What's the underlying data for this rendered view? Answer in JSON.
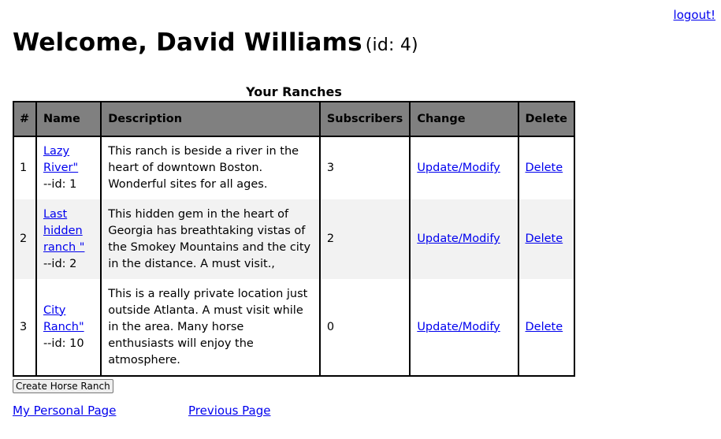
{
  "header": {
    "logout_label": "logout!",
    "welcome_text": "Welcome, David Williams",
    "user_id_text": "(id: 4)"
  },
  "table": {
    "caption": "Your Ranches",
    "columns": [
      "#",
      "Name",
      "Description",
      "Subscribers",
      "Change",
      "Delete"
    ],
    "rows": [
      {
        "num": "1",
        "name": "Lazy River\"",
        "id_text": "--id: 1",
        "description": "This ranch is beside a river in the heart of downtown Boston. Wonderful sites for all ages.",
        "subscribers": "3",
        "change_label": "Update/Modify",
        "delete_label": "Delete"
      },
      {
        "num": "2",
        "name": "Last hidden ranch \"",
        "id_text": "--id: 2",
        "description": "This hidden gem in the heart of Georgia has breathtaking vistas of the Smokey Mountains and the city in the distance. A must visit.,",
        "subscribers": "2",
        "change_label": "Update/Modify",
        "delete_label": "Delete"
      },
      {
        "num": "3",
        "name": "City Ranch\"",
        "id_text": "--id: 10",
        "description": "This is a really private location just outside Atlanta. A must visit while in the area. Many horse enthusiasts will enjoy the atmosphere.",
        "subscribers": "0",
        "change_label": "Update/Modify",
        "delete_label": "Delete"
      }
    ]
  },
  "actions": {
    "create_label": "Create Horse Ranch"
  },
  "footer": {
    "personal_page_label": "My Personal Page",
    "previous_page_label": "Previous Page"
  },
  "colors": {
    "header_bg": "#808080",
    "alt_row_bg": "#f2f2f2",
    "link": "#0000ee"
  }
}
